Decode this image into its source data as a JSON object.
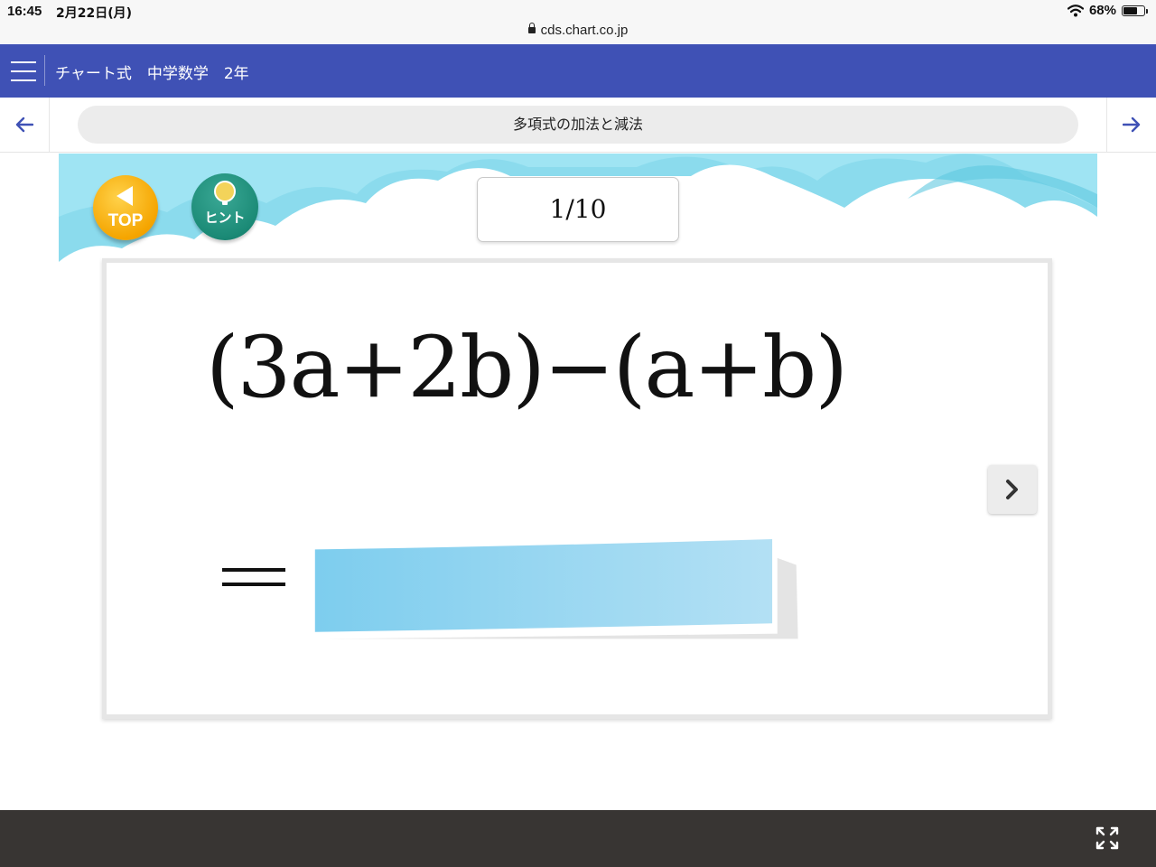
{
  "status_bar": {
    "time": "16:45",
    "date": "2月22日(月)",
    "url": "cds.chart.co.jp",
    "battery": "68%",
    "battery_level": 0.68
  },
  "header": {
    "title": "チャート式　中学数学　2年",
    "color": "#3f51b5"
  },
  "nav": {
    "lesson_title": "多項式の加法と減法"
  },
  "stage": {
    "top_button_label": "TOP",
    "hint_button_label": "ヒント",
    "progress": "1/10"
  },
  "question": {
    "expression": "(3a+2b)−(a+b)",
    "answer_value": ""
  },
  "icons": {
    "menu": "hamburger-icon",
    "back": "arrow-left-icon",
    "forward": "arrow-right-icon",
    "top": "triangle-left-icon",
    "hint": "lightbulb-icon",
    "next": "chevron-right-icon",
    "fullscreen": "fullscreen-icon"
  }
}
